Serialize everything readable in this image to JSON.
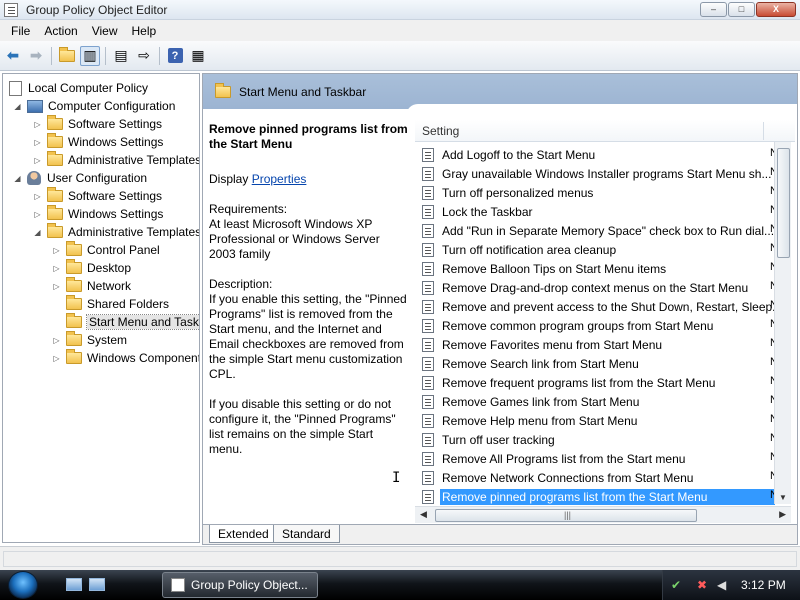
{
  "window": {
    "title": "Group Policy Object Editor",
    "buttons": {
      "minimize": "–",
      "maximize": "□",
      "close": "X"
    }
  },
  "menubar": {
    "items": [
      "File",
      "Action",
      "View",
      "Help"
    ]
  },
  "toolbar": {
    "icons": [
      "back-arrow-icon",
      "forward-arrow-icon",
      "up-folder-icon",
      "show-hide-tree-icon",
      "properties-icon",
      "export-list-icon",
      "help-icon",
      "extended-view-icon"
    ]
  },
  "tree": {
    "items": [
      {
        "label": "Local Computer Policy",
        "icon": "document-icon",
        "expander": ""
      },
      {
        "label": "Computer Configuration",
        "icon": "computer-icon",
        "expander": "◢"
      },
      {
        "label": "Software Settings",
        "icon": "folder-icon",
        "expander": "▷"
      },
      {
        "label": "Windows Settings",
        "icon": "folder-icon",
        "expander": "▷"
      },
      {
        "label": "Administrative Templates",
        "icon": "folder-icon",
        "expander": "▷"
      },
      {
        "label": "User Configuration",
        "icon": "user-icon",
        "expander": "◢"
      },
      {
        "label": "Software Settings",
        "icon": "folder-icon",
        "expander": "▷"
      },
      {
        "label": "Windows Settings",
        "icon": "folder-icon",
        "expander": "▷"
      },
      {
        "label": "Administrative Templates",
        "icon": "folder-icon",
        "expander": "◢"
      },
      {
        "label": "Control Panel",
        "icon": "folder-icon",
        "expander": "▷"
      },
      {
        "label": "Desktop",
        "icon": "folder-icon",
        "expander": "▷"
      },
      {
        "label": "Network",
        "icon": "folder-icon",
        "expander": "▷"
      },
      {
        "label": "Shared Folders",
        "icon": "folder-icon",
        "expander": ""
      },
      {
        "label": "Start Menu and Taskbar",
        "icon": "folder-icon",
        "expander": ""
      },
      {
        "label": "System",
        "icon": "folder-icon",
        "expander": "▷"
      },
      {
        "label": "Windows Components",
        "icon": "folder-icon",
        "expander": "▷"
      }
    ]
  },
  "pane": {
    "header_title": "Start Menu and Taskbar",
    "description": {
      "title": "Remove pinned programs list from the Start Menu",
      "display_prefix": "Display ",
      "display_link": "Properties",
      "requirements_heading": "Requirements:",
      "requirements_text": "At least Microsoft Windows XP Professional or Windows Server 2003 family",
      "description_heading": "Description:",
      "para1": "If you enable this setting, the \"Pinned Programs\" list is removed from the Start menu, and the Internet and Email checkboxes are removed from the simple Start menu customization CPL.",
      "para2": "If you disable this setting or do not configure it, the \"Pinned Programs\" list remains on the simple Start menu."
    },
    "list_column": "Setting",
    "state_glyph": "N",
    "settings": [
      "Add Logoff to the Start Menu",
      "Gray unavailable Windows Installer programs Start Menu sh...",
      "Turn off personalized menus",
      "Lock the Taskbar",
      "Add \"Run in Separate Memory Space\" check box to Run dial...",
      "Turn off notification area cleanup",
      "Remove Balloon Tips on Start Menu items",
      "Remove Drag-and-drop context menus on the Start Menu",
      "Remove and prevent access to the Shut Down, Restart, Sleep...",
      "Remove common program groups from Start Menu",
      "Remove Favorites menu from Start Menu",
      "Remove Search link from Start Menu",
      "Remove frequent programs list from the Start Menu",
      "Remove Games link from Start Menu",
      "Remove Help menu from Start Menu",
      "Turn off user tracking",
      "Remove All Programs list from the Start menu",
      "Remove Network Connections from Start Menu",
      "Remove pinned programs list from the Start Menu"
    ],
    "selected_index": 18,
    "tabs": [
      "Extended",
      "Standard"
    ]
  },
  "taskbar": {
    "task_label": "Group Policy Object...",
    "clock": "3:12 PM"
  }
}
